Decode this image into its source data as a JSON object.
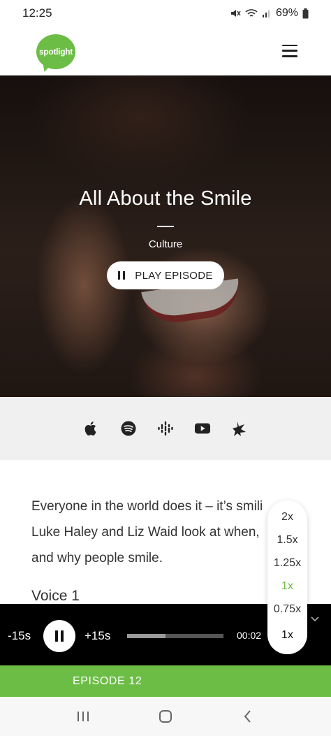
{
  "status_bar": {
    "time": "12:25",
    "battery": "69%"
  },
  "header": {
    "logo_text": "spotlight",
    "menu_icon": "hamburger-icon"
  },
  "hero": {
    "title": "All About the Smile",
    "category": "Culture",
    "play_label": "PLAY EPISODE"
  },
  "platforms": [
    {
      "name": "apple-podcasts-icon"
    },
    {
      "name": "spotify-icon"
    },
    {
      "name": "google-podcasts-icon"
    },
    {
      "name": "youtube-icon"
    },
    {
      "name": "spreaker-icon"
    }
  ],
  "article": {
    "body": "Everyone in the world does it – it’s smili Luke Haley and Liz Waid look at when, and why people smile.",
    "line1": "Everyone in the world does it – it’s smili",
    "line2": "Luke Haley and Liz Waid look at when,",
    "line3": "and why people smile.",
    "heading": "Voice 1"
  },
  "speed_menu": {
    "options": [
      "2x",
      "1.5x",
      "1.25x",
      "1x",
      "0.75x"
    ],
    "active": "1x",
    "current": "1x"
  },
  "player": {
    "skip_back": "-15s",
    "skip_forward": "+15s",
    "time": "00:02",
    "progress": 0.4
  },
  "episode_bar": {
    "label": "EPISODE 12"
  },
  "colors": {
    "brand_green": "#6cbd45",
    "player_bg": "#000000"
  }
}
